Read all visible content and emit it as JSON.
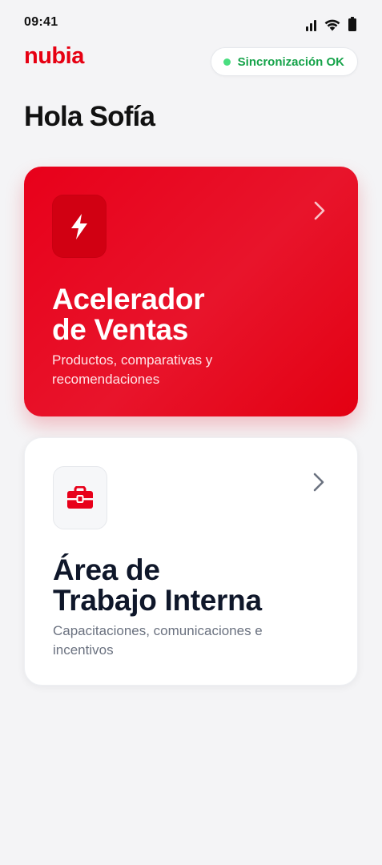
{
  "status_bar": {
    "time": "09:41",
    "icons": [
      "cellular-signal-icon",
      "wifi-icon",
      "battery-icon"
    ]
  },
  "header": {
    "logo_text": "nubia",
    "sync_status": "Sincronización OK",
    "sync_status_color": "#16a34a",
    "sync_dot_color": "#4ade80"
  },
  "greeting": "Hola Sofía",
  "cards": [
    {
      "title_line1": "Acelerador",
      "title_line2": "de Ventas",
      "subtitle": "Productos, comparativas y recomendaciones",
      "icon": "lightning-bolt-icon",
      "background": "#e8001a"
    },
    {
      "title_line1": "Área de",
      "title_line2": "Trabajo Interna",
      "subtitle": "Capacitaciones, comunicaciones e incentivos",
      "icon": "briefcase-icon",
      "background": "#ffffff"
    }
  ],
  "colors": {
    "brand_red": "#e60012",
    "page_background": "#f4f4f6"
  }
}
